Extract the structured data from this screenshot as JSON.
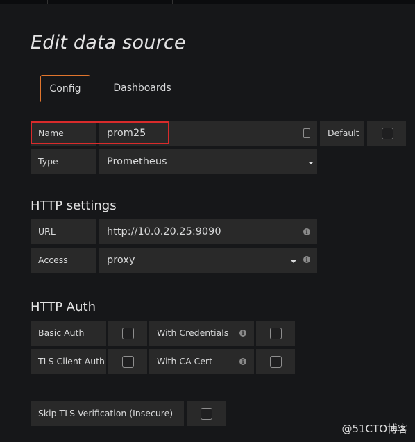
{
  "page": {
    "title": "Edit data source"
  },
  "tabs": [
    {
      "label": "Config",
      "active": true
    },
    {
      "label": "Dashboards",
      "active": false
    }
  ],
  "general": {
    "name_label": "Name",
    "name_value": "prom25",
    "default_label": "Default",
    "default_checked": false,
    "type_label": "Type",
    "type_value": "Prometheus"
  },
  "http_settings": {
    "heading": "HTTP settings",
    "url_label": "URL",
    "url_value": "http://10.0.20.25:9090",
    "access_label": "Access",
    "access_value": "proxy"
  },
  "http_auth": {
    "heading": "HTTP Auth",
    "basic_auth_label": "Basic Auth",
    "basic_auth_checked": false,
    "with_credentials_label": "With Credentials",
    "with_credentials_checked": false,
    "tls_client_auth_label": "TLS Client Auth",
    "tls_client_auth_checked": false,
    "with_ca_cert_label": "With CA Cert",
    "with_ca_cert_checked": false,
    "skip_tls_label": "Skip TLS Verification (Insecure)",
    "skip_tls_checked": false
  },
  "watermark": "@51CTO博客",
  "colors": {
    "background": "#161719",
    "panel": "#292929",
    "accent": "#e0752d",
    "highlight": "#d92b2b"
  }
}
